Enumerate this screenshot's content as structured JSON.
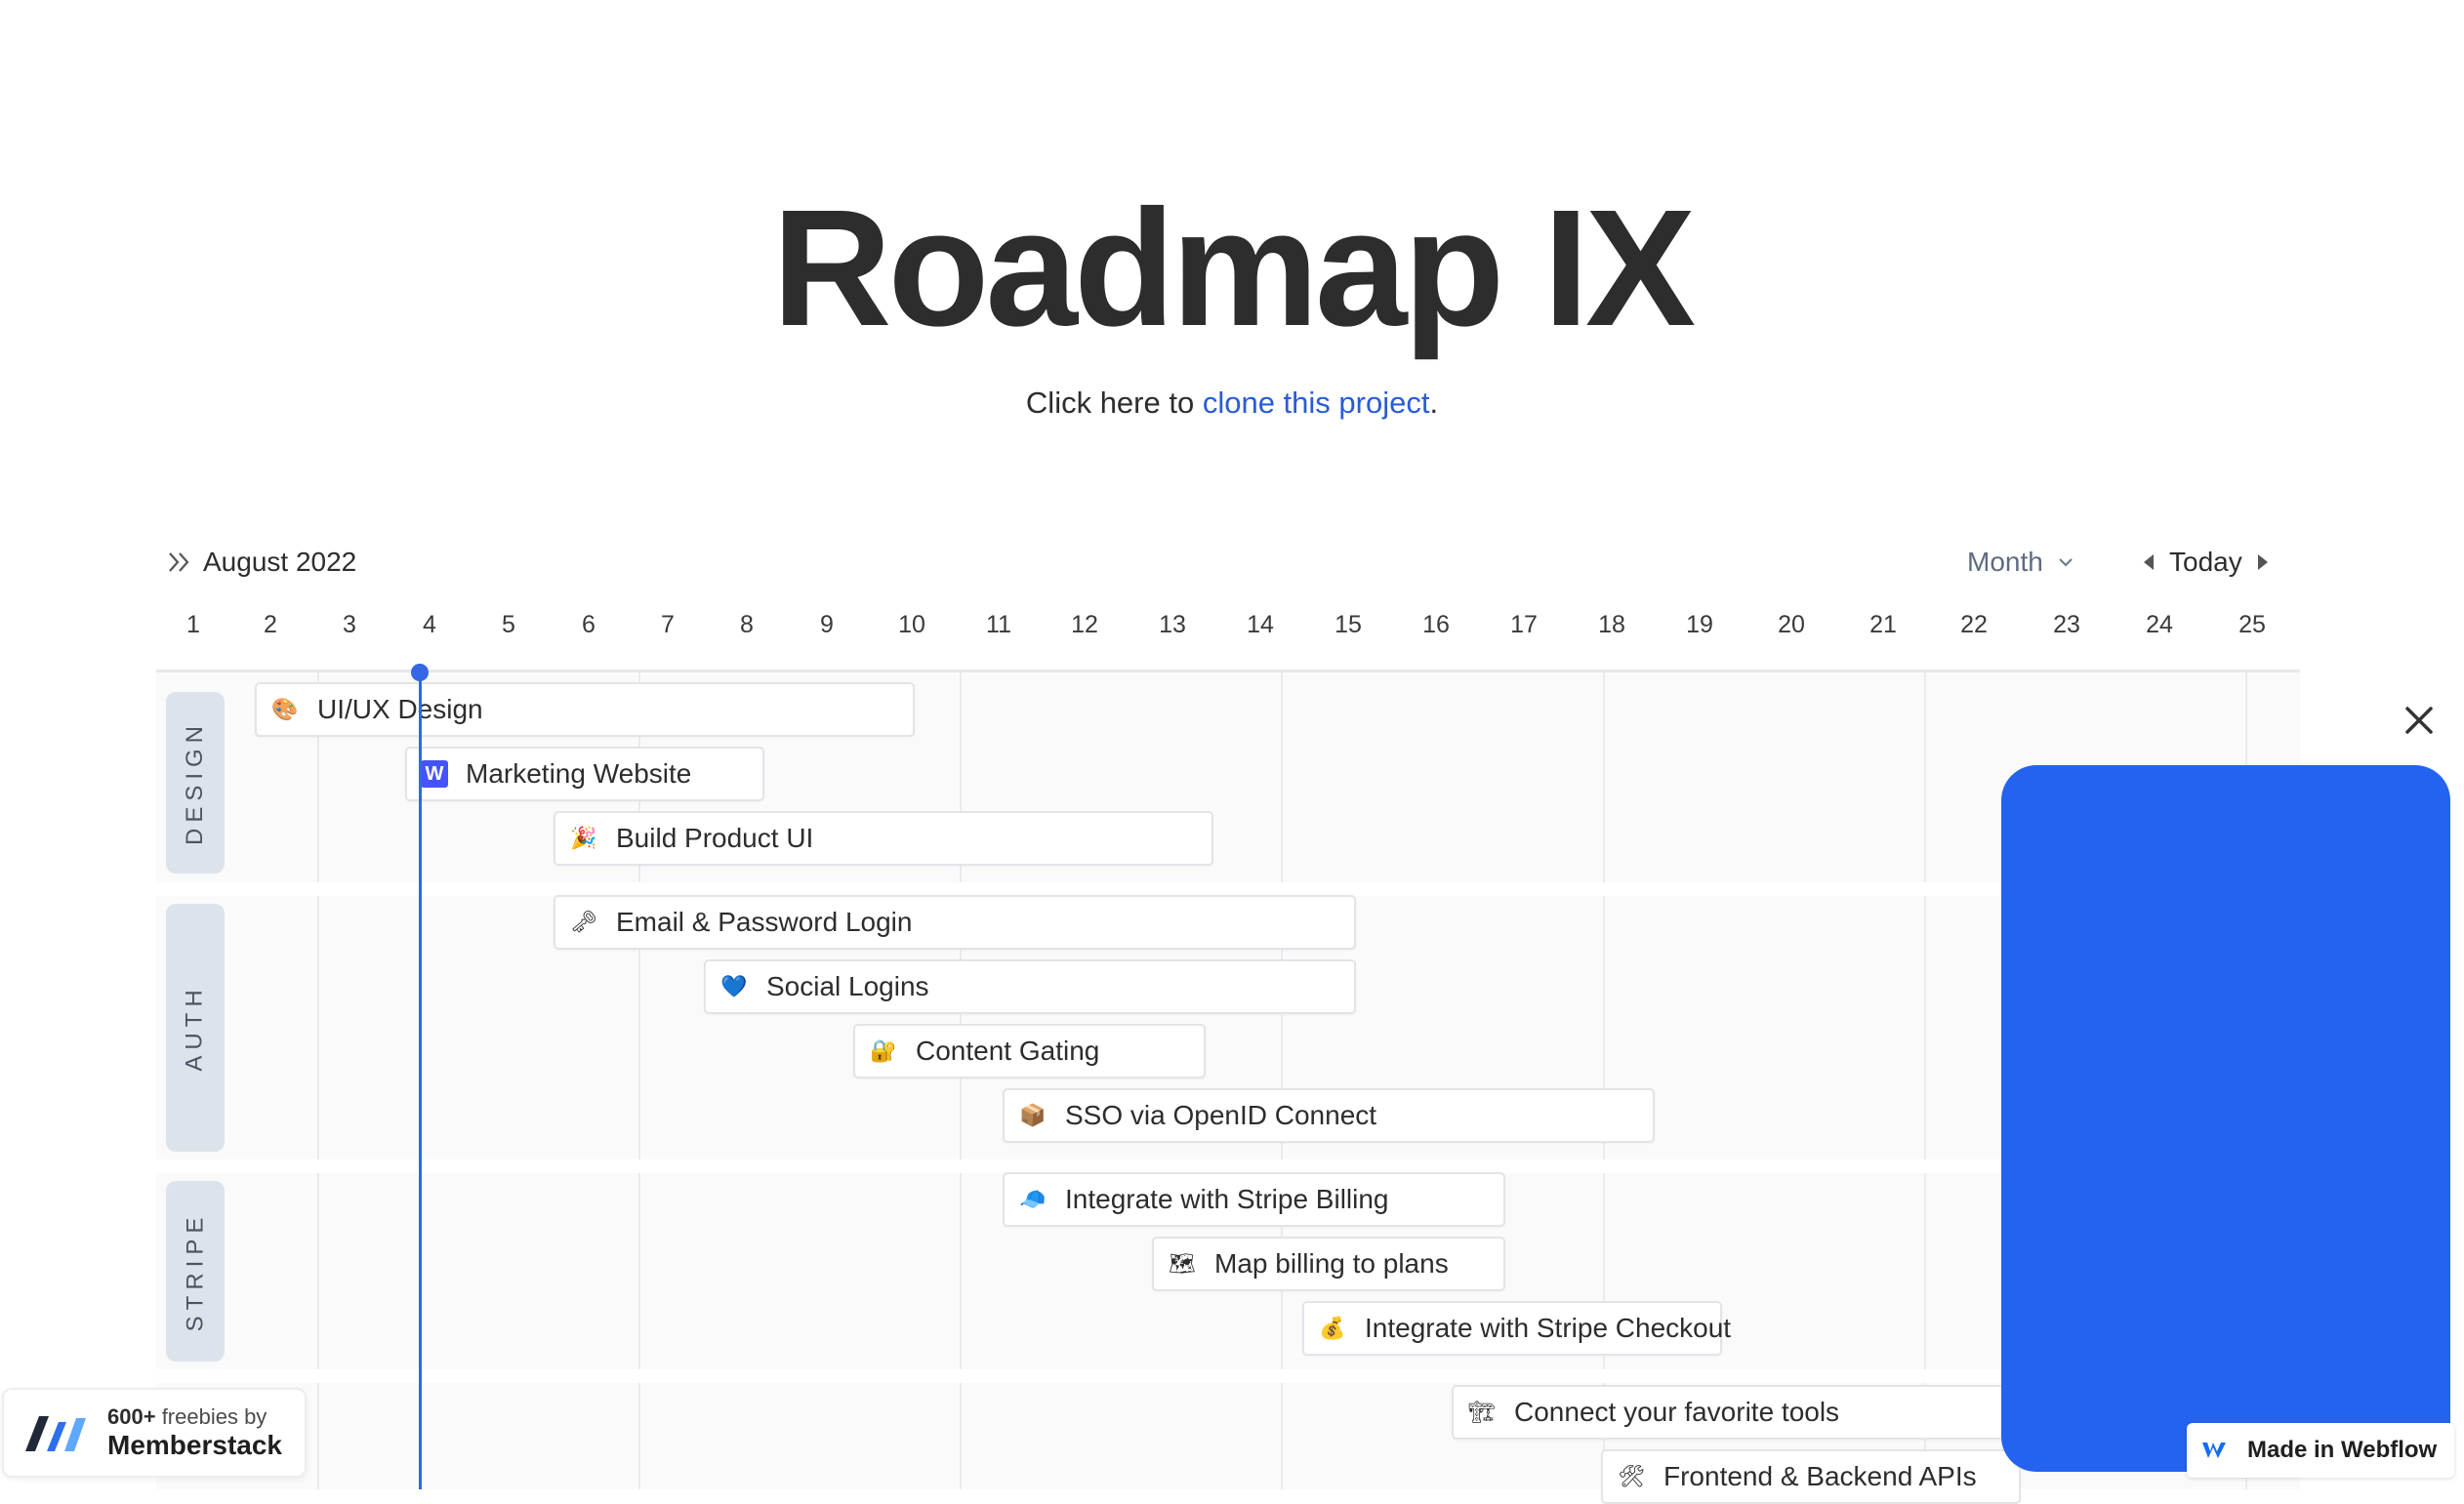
{
  "page": {
    "title": "Roadmap IX"
  },
  "subtitle": {
    "prefix": "Click here to ",
    "link": "clone this project",
    "suffix": "."
  },
  "toolbar": {
    "month_label": "August 2022",
    "view": "Month",
    "today": "Today"
  },
  "days": [
    "1",
    "2",
    "3",
    "4",
    "5",
    "6",
    "7",
    "8",
    "9",
    "10",
    "11",
    "12",
    "13",
    "14",
    "15",
    "16",
    "17",
    "18",
    "19",
    "20",
    "21",
    "22",
    "23",
    "24",
    "25"
  ],
  "groups": [
    "DESIGN",
    "AUTH",
    "STRIPE"
  ],
  "tasks": [
    {
      "label": "UI/UX Design",
      "icon": "palette-icon",
      "glyph": "🎨"
    },
    {
      "label": "Marketing Website",
      "icon": "webflow-icon",
      "glyph": "W"
    },
    {
      "label": "Build Product UI",
      "icon": "party-popper-icon",
      "glyph": "🎉"
    },
    {
      "label": "Email & Password Login",
      "icon": "key-icon",
      "glyph": "🗝"
    },
    {
      "label": "Social Logins",
      "icon": "blue-heart-icon",
      "glyph": "💙"
    },
    {
      "label": "Content Gating",
      "icon": "lock-icon",
      "glyph": "🔐"
    },
    {
      "label": "SSO via OpenID Connect",
      "icon": "package-icon",
      "glyph": "📦"
    },
    {
      "label": "Integrate with Stripe Billing",
      "icon": "cap-icon",
      "glyph": "🧢"
    },
    {
      "label": "Map billing to plans",
      "icon": "map-icon",
      "glyph": "🗺"
    },
    {
      "label": "Integrate with Stripe Checkout",
      "icon": "money-bag-icon",
      "glyph": "💰"
    },
    {
      "label": "Connect your favorite tools",
      "icon": "crane-icon",
      "glyph": "🏗"
    },
    {
      "label": "Frontend & Backend APIs",
      "icon": "tools-icon",
      "glyph": "🛠"
    }
  ],
  "badges": {
    "webflow": "Made in Webflow",
    "memberstack_count": "600+",
    "memberstack_top": "freebies by",
    "memberstack_name": "Memberstack"
  },
  "colors": {
    "accent": "#2a5bd7",
    "today_line": "#3466e6",
    "panel": "#2463f0"
  }
}
